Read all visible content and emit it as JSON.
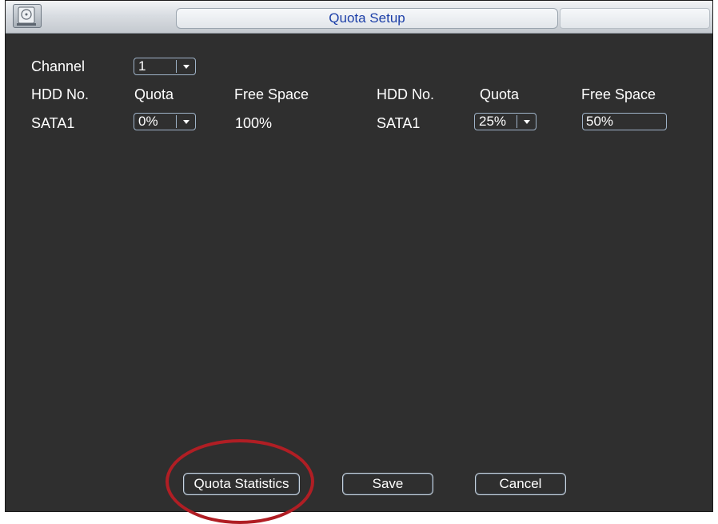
{
  "window": {
    "title": "Quota Setup",
    "app_icon": "hdd-icon"
  },
  "channel": {
    "label": "Channel",
    "value": "1"
  },
  "headers": {
    "left": {
      "hdd": "HDD No.",
      "quota": "Quota",
      "free": "Free Space"
    },
    "right": {
      "hdd": "HDD No.",
      "quota": "Quota",
      "free": "Free Space"
    }
  },
  "row_left": {
    "hdd": "SATA1",
    "quota": "0%",
    "free": "100%"
  },
  "row_right": {
    "hdd": "SATA1",
    "quota": "25%",
    "free": "50%"
  },
  "buttons": {
    "quota_statistics": "Quota Statistics",
    "save": "Save",
    "cancel": "Cancel"
  },
  "colors": {
    "panel_bg": "#2f2f2f",
    "title_text": "#1c3fa8",
    "field_border": "#9fb3c8",
    "highlight_circle": "#b01e24"
  }
}
